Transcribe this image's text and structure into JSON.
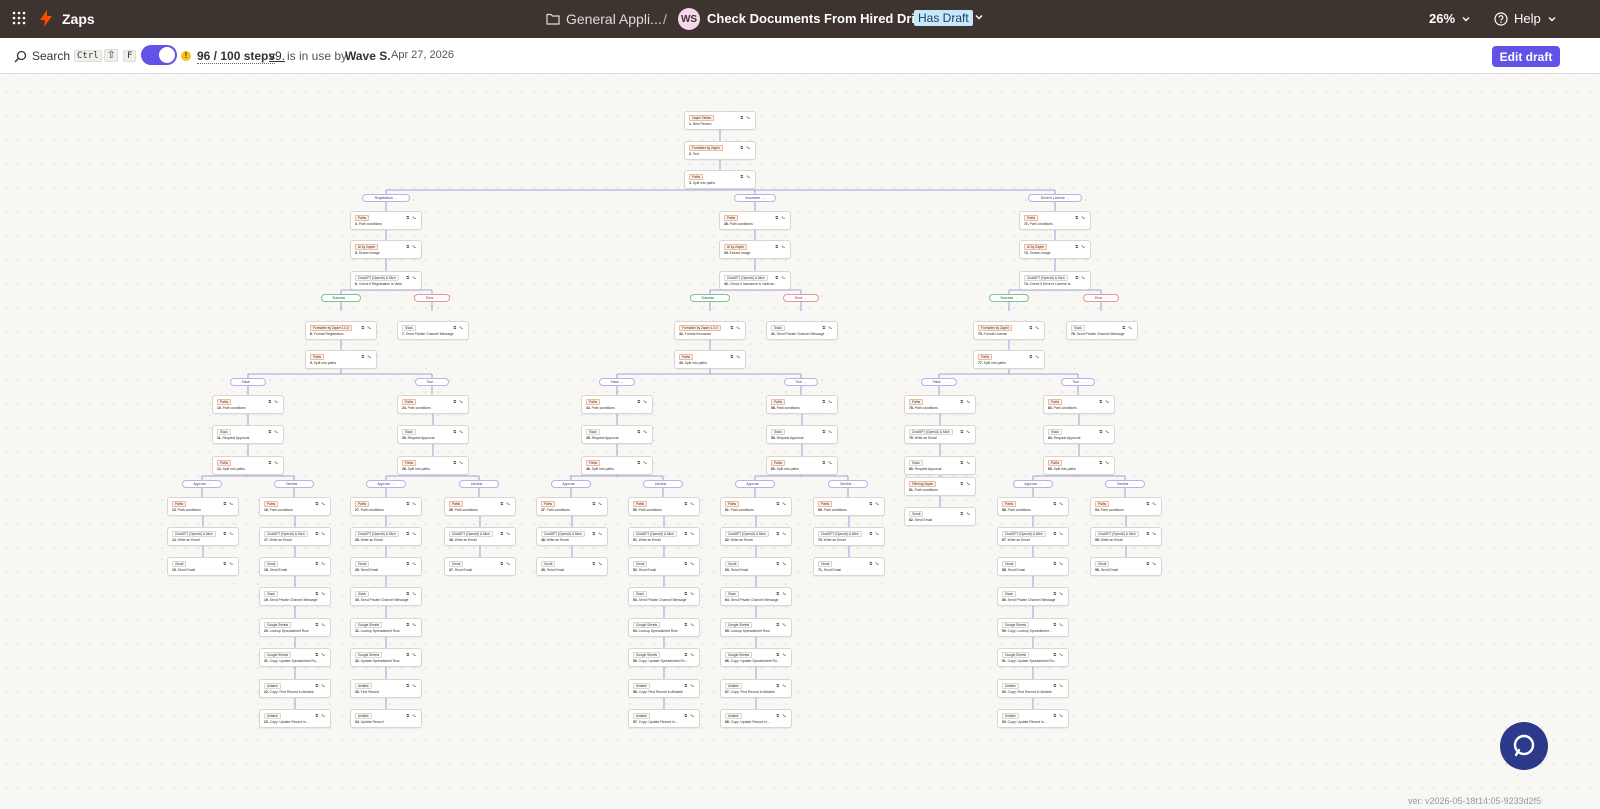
{
  "header": {
    "app_name": "Zaps",
    "folder": "General Appli...",
    "separator": "/",
    "avatar": "WS",
    "zap_title": "Check Documents From Hired Drivers",
    "draft_badge": "Has Draft",
    "zoom": "26%",
    "help": "Help"
  },
  "subbar": {
    "search": "Search",
    "kbd_ctrl": "Ctrl",
    "kbd_shift": "⇧",
    "kbd_f": "F",
    "steps": "96 / 100 steps",
    "version": "v9.",
    "in_use": "is in use by",
    "user": "Wave S.",
    "date": "Apr 27, 2026",
    "edit_draft": "Edit draft"
  },
  "colors": {
    "topbar": "#3d3430",
    "accent": "#6152e8",
    "zap_orange": "#ff4a00",
    "chat": "#2d3a8c",
    "path_line": "#8a84d6"
  },
  "version_footer": "ver. v2026-05-18t14:05-9233d2f5",
  "flow": {
    "nodes": [
      {
        "app": "Zapier Tables",
        "n": "1.",
        "t": "New Record"
      },
      {
        "app": "Formatter by Zapier",
        "n": "2.",
        "t": "Text"
      },
      {
        "app": "Paths",
        "n": "3.",
        "t": "Split into paths"
      },
      {
        "app": "Paths",
        "n": "4.",
        "t": "Path conditions"
      },
      {
        "app": "AI by Zapier",
        "n": "5.",
        "t": "Screen image"
      },
      {
        "app": "ChatGPT (OpenAI) & Mich",
        "n": "6.",
        "t": "Check if Registration is Valid"
      },
      {
        "app": "Formatter by Zapier 1.0.0",
        "n": "8.",
        "t": "Format Registration"
      },
      {
        "app": "Slack",
        "n": "7.",
        "t": "Send Private Channel Message"
      },
      {
        "app": "Paths",
        "n": "9.",
        "t": "Split into paths"
      },
      {
        "app": "Paths",
        "n": "10.",
        "t": "Path conditions"
      },
      {
        "app": "Slack",
        "n": "11.",
        "t": "Request Approval"
      },
      {
        "app": "Paths",
        "n": "12.",
        "t": "Split into paths"
      },
      {
        "app": "Paths",
        "n": "13.",
        "t": "Path conditions"
      },
      {
        "app": "ChatGPT (OpenAI) & Mich",
        "n": "14.",
        "t": "Write an Email"
      },
      {
        "app": "Gmail",
        "n": "15.",
        "t": "Send Email"
      },
      {
        "app": "Paths",
        "n": "16.",
        "t": "Path conditions"
      },
      {
        "app": "ChatGPT (OpenAI) & Mich",
        "n": "17.",
        "t": "Write an Email"
      },
      {
        "app": "Gmail",
        "n": "18.",
        "t": "Send Email"
      },
      {
        "app": "Slack",
        "n": "19.",
        "t": "Send Private Channel Message"
      },
      {
        "app": "Google Sheets",
        "n": "20.",
        "t": "Lookup Spreadsheet Row"
      },
      {
        "app": "Google Sheets",
        "n": "21.",
        "t": "Copy: Update Spreadsheet Ro..."
      },
      {
        "app": "Airtable",
        "n": "22.",
        "t": "Copy: Find Record in Airtable"
      },
      {
        "app": "Airtable",
        "n": "23.",
        "t": "Copy: Update Record in..."
      },
      {
        "app": "Paths",
        "n": "24.",
        "t": "Path conditions"
      },
      {
        "app": "Slack",
        "n": "25.",
        "t": "Request Approval"
      },
      {
        "app": "Paths",
        "n": "26.",
        "t": "Split into paths"
      },
      {
        "app": "Paths",
        "n": "27.",
        "t": "Path conditions"
      },
      {
        "app": "ChatGPT (OpenAI) & Mich",
        "n": "28.",
        "t": "Write an Email"
      },
      {
        "app": "Gmail",
        "n": "29.",
        "t": "Send Email"
      },
      {
        "app": "Slack",
        "n": "30.",
        "t": "Send Private Channel Message"
      },
      {
        "app": "Google Sheets",
        "n": "31.",
        "t": "Lookup Spreadsheet Row"
      },
      {
        "app": "Google Sheets",
        "n": "32.",
        "t": "Update Spreadsheet Row"
      },
      {
        "app": "Airtable",
        "n": "33.",
        "t": "Find Record"
      },
      {
        "app": "Airtable",
        "n": "34.",
        "t": "Update Record"
      },
      {
        "app": "Paths",
        "n": "35.",
        "t": "Path conditions"
      },
      {
        "app": "ChatGPT (OpenAI) & Mich",
        "n": "36.",
        "t": "Write an Email"
      },
      {
        "app": "Gmail",
        "n": "37.",
        "t": "Send Email"
      },
      {
        "app": "Paths",
        "n": "38.",
        "t": "Path conditions"
      },
      {
        "app": "AI by Zapier",
        "n": "39.",
        "t": "Extract image"
      },
      {
        "app": "ChatGPT (OpenAI) & Mich",
        "n": "40.",
        "t": "Check if Insurance is Valid an..."
      },
      {
        "app": "Formatter by Zapier 1.0.0",
        "n": "42.",
        "t": "Format Insurance"
      },
      {
        "app": "Slack",
        "n": "41.",
        "t": "Send Private Channel Message"
      },
      {
        "app": "Paths",
        "n": "43.",
        "t": "Split into paths"
      },
      {
        "app": "Paths",
        "n": "44.",
        "t": "Path conditions"
      },
      {
        "app": "Slack",
        "n": "45.",
        "t": "Request Approval"
      },
      {
        "app": "Paths",
        "n": "46.",
        "t": "Split into paths"
      },
      {
        "app": "Paths",
        "n": "47.",
        "t": "Path conditions"
      },
      {
        "app": "ChatGPT (OpenAI) & Mich",
        "n": "48.",
        "t": "Write an Email"
      },
      {
        "app": "Gmail",
        "n": "49.",
        "t": "Send Email"
      },
      {
        "app": "Paths",
        "n": "50.",
        "t": "Path conditions"
      },
      {
        "app": "ChatGPT (OpenAI) & Mich",
        "n": "51.",
        "t": "Write an Email"
      },
      {
        "app": "Gmail",
        "n": "52.",
        "t": "Send Email"
      },
      {
        "app": "Slack",
        "n": "53.",
        "t": "Send Private Channel Message"
      },
      {
        "app": "Google Sheets",
        "n": "54.",
        "t": "Lookup Spreadsheet Row"
      },
      {
        "app": "Google Sheets",
        "n": "55.",
        "t": "Copy: Update Spreadsheet Ro..."
      },
      {
        "app": "Airtable",
        "n": "56.",
        "t": "Copy: Find Record in Airtable"
      },
      {
        "app": "Airtable",
        "n": "57.",
        "t": "Copy: Update Record in..."
      },
      {
        "app": "Paths",
        "n": "58.",
        "t": "Path conditions"
      },
      {
        "app": "Slack",
        "n": "59.",
        "t": "Request Approval"
      },
      {
        "app": "Paths",
        "n": "60.",
        "t": "Split into paths"
      },
      {
        "app": "Paths",
        "n": "61.",
        "t": "Path conditions"
      },
      {
        "app": "ChatGPT (OpenAI) & Mich",
        "n": "62.",
        "t": "Write an Email"
      },
      {
        "app": "Gmail",
        "n": "63.",
        "t": "Send Email"
      },
      {
        "app": "Slack",
        "n": "64.",
        "t": "Send Private Channel Message"
      },
      {
        "app": "Google Sheets",
        "n": "65.",
        "t": "Lookup Spreadsheet Row"
      },
      {
        "app": "Google Sheets",
        "n": "66.",
        "t": "Copy: Update Spreadsheet Ro..."
      },
      {
        "app": "Airtable",
        "n": "67.",
        "t": "Copy: Find Record in Airtable"
      },
      {
        "app": "Airtable",
        "n": "68.",
        "t": "Copy: Update Record in..."
      },
      {
        "app": "Paths",
        "n": "69.",
        "t": "Path conditions"
      },
      {
        "app": "ChatGPT (OpenAI) & Mich",
        "n": "70.",
        "t": "Write an Email"
      },
      {
        "app": "Gmail",
        "n": "71.",
        "t": "Send Email"
      },
      {
        "app": "Paths",
        "n": "72.",
        "t": "Path conditions"
      },
      {
        "app": "AI by Zapier",
        "n": "73.",
        "t": "Screen image"
      },
      {
        "app": "ChatGPT (OpenAI) & Mich",
        "n": "74.",
        "t": "Check if Driver's License is..."
      },
      {
        "app": "Formatter by Zapier",
        "n": "75.",
        "t": "Format License"
      },
      {
        "app": "Slack",
        "n": "76.",
        "t": "Send Private Channel Message"
      },
      {
        "app": "Paths",
        "n": "77.",
        "t": "Split into paths"
      },
      {
        "app": "Paths",
        "n": "78.",
        "t": "Path conditions"
      },
      {
        "app": "ChatGPT (OpenAI) & Mich",
        "n": "79.",
        "t": "Write an Email"
      },
      {
        "app": "Slack",
        "n": "80.",
        "t": "Request Approval"
      },
      {
        "app": "Filtering Zapier",
        "n": "81.",
        "t": "Path conditions"
      },
      {
        "app": "Gmail",
        "n": "82.",
        "t": "Send Email"
      },
      {
        "app": "Paths",
        "n": "83.",
        "t": "Path conditions"
      },
      {
        "app": "Slack",
        "n": "84.",
        "t": "Request Approval"
      },
      {
        "app": "Paths",
        "n": "85.",
        "t": "Split into paths"
      },
      {
        "app": "Paths",
        "n": "86.",
        "t": "Path conditions"
      },
      {
        "app": "ChatGPT (OpenAI) & Mich",
        "n": "87.",
        "t": "Write an Email"
      },
      {
        "app": "Gmail",
        "n": "88.",
        "t": "Send Email"
      },
      {
        "app": "Slack",
        "n": "89.",
        "t": "Send Private Channel Message"
      },
      {
        "app": "Google Sheets",
        "n": "90.",
        "t": "Copy: Lookup Spreadsheet..."
      },
      {
        "app": "Google Sheets",
        "n": "91.",
        "t": "Copy: Update Spreadsheet Ro..."
      },
      {
        "app": "Airtable",
        "n": "92.",
        "t": "Copy: Find Record in Airtable"
      },
      {
        "app": "Airtable",
        "n": "93.",
        "t": "Copy: Update Record in..."
      },
      {
        "app": "Paths",
        "n": "94.",
        "t": "Path conditions"
      },
      {
        "app": "ChatGPT (OpenAI) & Mich",
        "n": "95.",
        "t": "Write an Email"
      },
      {
        "app": "Gmail",
        "n": "96.",
        "t": "Send Email"
      }
    ],
    "pills": [
      "Registration",
      "Insurance",
      "Driver's License",
      "Success",
      "Error",
      "Success",
      "Error",
      "Success",
      "Error",
      "False",
      "True",
      "False",
      "True",
      "False",
      "True",
      "Approve",
      "Decline",
      "Approve",
      "Decline",
      "Approve",
      "Decline",
      "Approve",
      "Decline",
      "Approve",
      "Decline"
    ]
  }
}
